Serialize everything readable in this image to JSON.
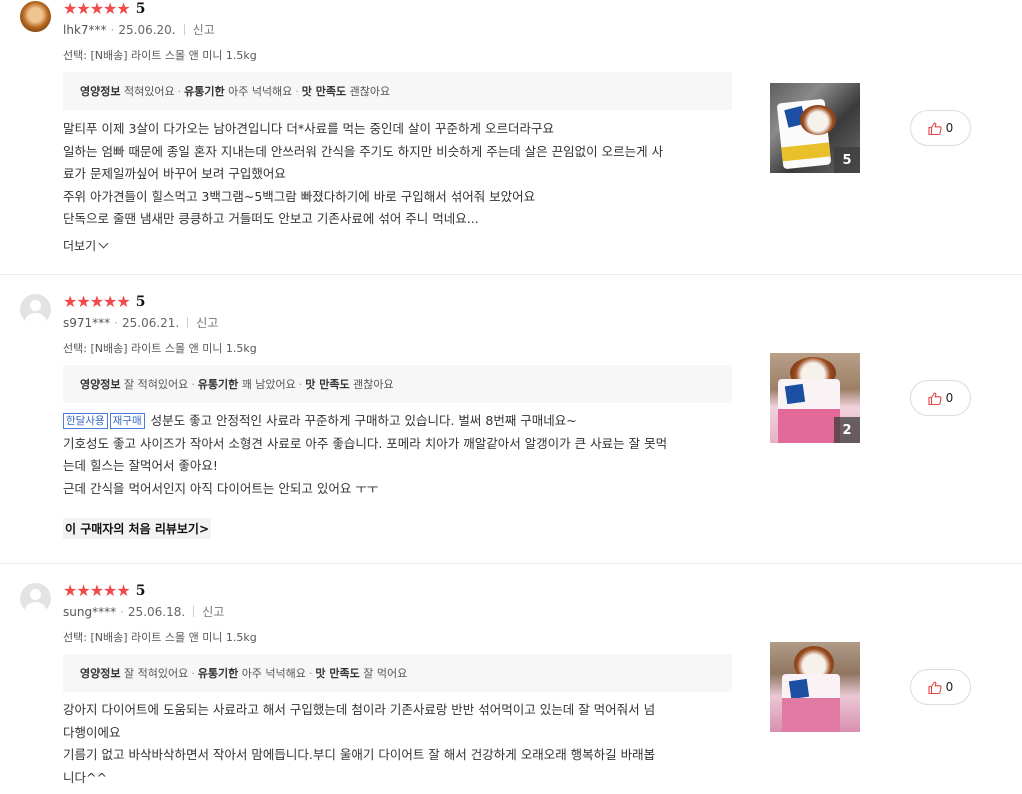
{
  "colors": {
    "star": "#f04a4a",
    "tag_border": "#4a7fd4",
    "like_icon": "#e04545"
  },
  "reviews": [
    {
      "avatar": "user-photo",
      "rating_stars": 5,
      "score": "5",
      "user": "lhk7***",
      "date": "25.06.20.",
      "report": "신고",
      "option": "선택: [N배송] 라이트 스몰 앤 미니 1.5kg",
      "attrs": [
        {
          "key": "영양정보",
          "value": "적혀있어요"
        },
        {
          "key": "유통기한",
          "value": "아주 넉넉해요"
        },
        {
          "key": "맛 만족도",
          "value": "괜찮아요"
        }
      ],
      "tags": [],
      "lines": [
        "말티푸 이제 3살이 다가오는 남아견입니다 더*사료를 먹는 중인데 살이 꾸준하게 오르더라구요",
        "일하는 엄빠 때문에 종일 혼자 지내는데 안쓰러워 간식을 주기도 하지만 비슷하게 주는데 살은 끈임없이 오르는게 사",
        "료가 문제일까싶어 바꾸어 보려 구입했어요",
        "주위 아가견들이 힐스먹고 3백그램~5백그람 빠졌다하기에 바로 구입해서 섞어줘 보았어요",
        "단독으로 줄땐 냄새만 킁킁하고 거들떠도 안보고 기존사료에 섞어 주니 먹네요..."
      ],
      "more_label": "더보기",
      "photo_count": "5",
      "likes": "0"
    },
    {
      "avatar": "default",
      "rating_stars": 5,
      "score": "5",
      "user": "s971***",
      "date": "25.06.21.",
      "report": "신고",
      "option": "선택: [N배송] 라이트 스몰 앤 미니 1.5kg",
      "attrs": [
        {
          "key": "영양정보",
          "value": "잘 적혀있어요"
        },
        {
          "key": "유통기한",
          "value": "꽤 남았어요"
        },
        {
          "key": "맛 만족도",
          "value": "괜찮아요"
        }
      ],
      "tags": [
        "한달사용",
        "재구매"
      ],
      "lines": [
        "성분도 좋고 안정적인 사료라 꾸준하게 구매하고 있습니다. 벌써 8번째 구매네요~",
        "기호성도 좋고 사이즈가 작아서 소형견 사료로 아주 좋습니다. 포메라 치아가 깨알같아서 알갱이가 큰 사료는 잘 못먹",
        "는데 힐스는 잘먹어서 좋아요!",
        "근데 간식을 먹어서인지 아직 다이어트는 안되고 있어요 ㅜㅜ"
      ],
      "first_review_label": "이 구매자의 처음 리뷰보기",
      "photo_count": "2",
      "likes": "0"
    },
    {
      "avatar": "default",
      "rating_stars": 5,
      "score": "5",
      "user": "sung****",
      "date": "25.06.18.",
      "report": "신고",
      "option": "선택: [N배송] 라이트 스몰 앤 미니 1.5kg",
      "attrs": [
        {
          "key": "영양정보",
          "value": "잘 적혀있어요"
        },
        {
          "key": "유통기한",
          "value": "아주 넉넉해요"
        },
        {
          "key": "맛 만족도",
          "value": "잘 먹어요"
        }
      ],
      "tags": [],
      "lines": [
        "강아지 다이어트에 도움되는 사료라고 해서 구입했는데 첨이라 기존사료랑 반반 섞어먹이고 있는데 잘 먹어줘서 넘",
        "다행이에요",
        "기름기 없고 바삭바삭하면서 작아서 맘에듭니다.부디 울애기 다이어트 잘 해서 건강하게 오래오래 행복하길 바래봅",
        "니다^^"
      ],
      "likes": "0"
    }
  ]
}
